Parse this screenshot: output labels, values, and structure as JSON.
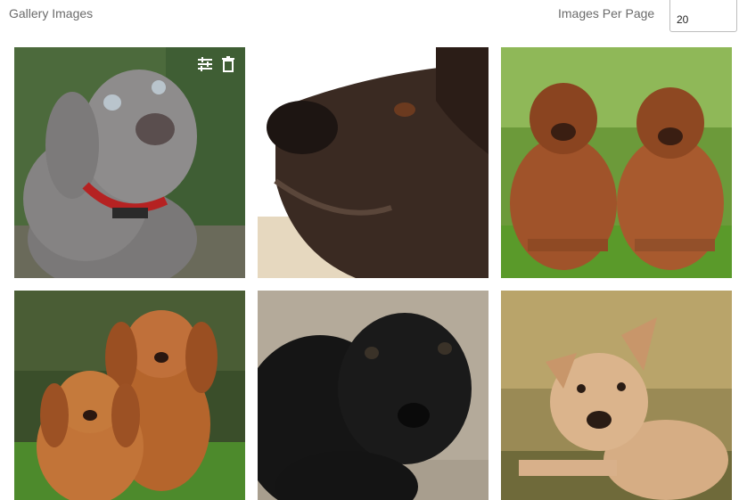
{
  "header": {
    "title": "Gallery Images",
    "per_page_label": "Images Per Page",
    "per_page_value": "20"
  },
  "gallery": {
    "images": [
      {
        "subject": "grey weimaraner puppy with red collar"
      },
      {
        "subject": "dark brindle dog nose close-up"
      },
      {
        "subject": "two dogue de bordeaux on grass"
      },
      {
        "subject": "two cavalier king charles puppies"
      },
      {
        "subject": "black puppy lying on blanket"
      },
      {
        "subject": "tan puppy lying in leaves"
      }
    ],
    "actions": [
      "adjust-icon",
      "trash-icon"
    ]
  }
}
